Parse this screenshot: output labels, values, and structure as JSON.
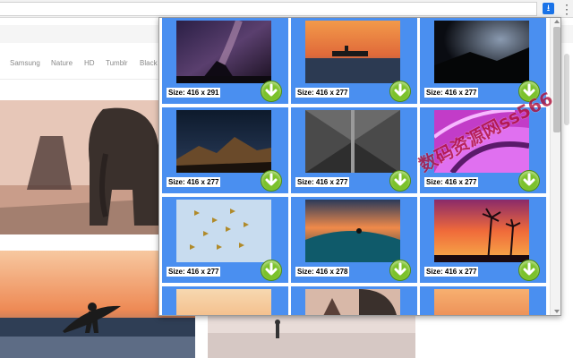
{
  "toolbar": {
    "extension_icon": "download-arrow-icon",
    "menu_icon": "vertical-dots-icon"
  },
  "site": {
    "tags": [
      "Samsung",
      "Nature",
      "HD",
      "Tumblr",
      "Black"
    ]
  },
  "popup": {
    "download_icon": "green-download-arrow-icon",
    "accent_color": "#4a8ff0",
    "button_color": "#7cc22c",
    "images": [
      {
        "size": "Size: 416 x 291",
        "subject": "milky way over rock"
      },
      {
        "size": "Size: 416 x 277",
        "subject": "plane wreck at sunset"
      },
      {
        "size": "Size: 416 x 277",
        "subject": "dark night sky"
      },
      {
        "size": "Size: 416 x 277",
        "subject": "mountains under stars"
      },
      {
        "size": "Size: 416 x 277",
        "subject": "symmetrical corridor"
      },
      {
        "size": "Size: 416 x 277",
        "subject": "purple abstract curves"
      },
      {
        "size": "Size: 416 x 277",
        "subject": "birds in blue sky"
      },
      {
        "size": "Size: 416 x 278",
        "subject": "surfer on wave at sunset"
      },
      {
        "size": "Size: 416 x 277",
        "subject": "palm trees at sunset"
      },
      {
        "size": "",
        "subject": "sunset sky"
      },
      {
        "size": "",
        "subject": "elephant"
      },
      {
        "size": "",
        "subject": "orange horizon"
      }
    ]
  },
  "watermark": {
    "text": "数码资源网ss566"
  }
}
